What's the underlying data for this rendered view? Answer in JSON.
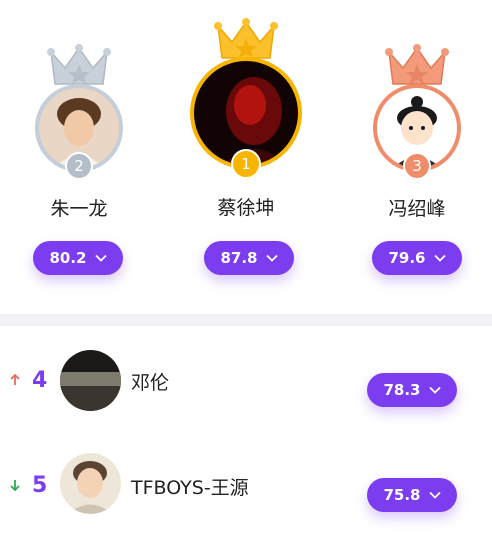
{
  "podium": [
    {
      "rank": "2",
      "name": "朱一龙",
      "score": "80.2"
    },
    {
      "rank": "1",
      "name": "蔡徐坤",
      "score": "87.8"
    },
    {
      "rank": "3",
      "name": "冯绍峰",
      "score": "79.6"
    }
  ],
  "list": [
    {
      "rank": "4",
      "trend": "up",
      "name": "邓伦",
      "score": "78.3"
    },
    {
      "rank": "5",
      "trend": "down",
      "name": "TFBOYS-王源",
      "score": "75.8"
    }
  ],
  "colors": {
    "accent": "#7c3cf0",
    "gold": "#f5b400",
    "silver": "#b7c2cc",
    "bronze": "#ec8a68",
    "trend_up": "#e76b5c",
    "trend_down": "#2fa84f"
  }
}
